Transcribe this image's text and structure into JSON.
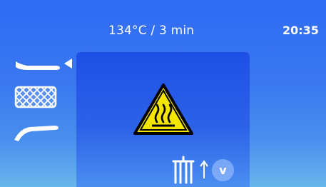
{
  "header": {
    "program": "134°C / 3 min",
    "time": "20:35"
  },
  "menu": {
    "items": [
      {
        "name": "handpiece-straight-icon",
        "selected": true
      },
      {
        "name": "basket-mesh-icon",
        "selected": false
      },
      {
        "name": "handpiece-curved-icon",
        "selected": false
      }
    ]
  },
  "panel": {
    "warning_icon": "hot-surface-warning-icon",
    "lift_icon": "lift-icon",
    "direction_icon": "arrow-up-icon",
    "confirm_label": "v"
  },
  "colors": {
    "background_top": "#2f6bf4",
    "background_bottom": "#69b6ec",
    "panel": "#1e4fe6",
    "warning_fill": "#f5e600",
    "warning_stroke": "#000000"
  }
}
